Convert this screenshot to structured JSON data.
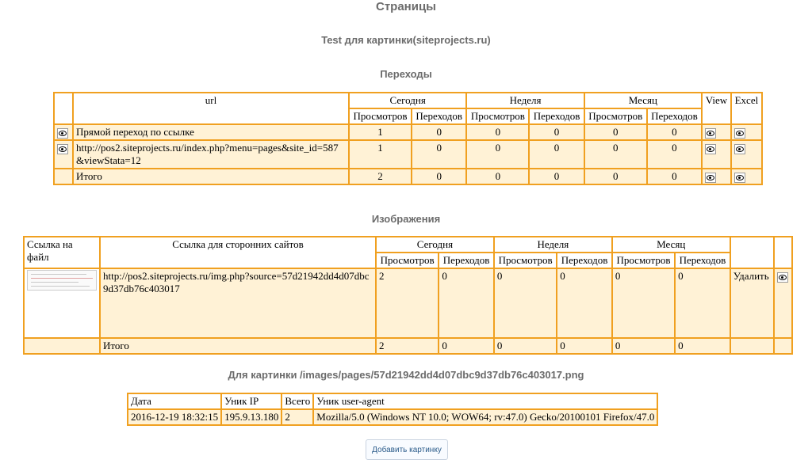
{
  "page_title": "Страницы",
  "site_title": "Test для картинки(siteprojects.ru)",
  "transitions": {
    "title": "Переходы",
    "headers": {
      "url": "url",
      "today": "Сегодня",
      "week": "Неделя",
      "month": "Месяц",
      "view": "View",
      "excel": "Excel",
      "views": "Просмотров",
      "clicks": "Переходов"
    },
    "rows": [
      {
        "url": "Прямой переход по ссылке",
        "v": [
          "1",
          "0",
          "0",
          "0",
          "0",
          "0"
        ]
      },
      {
        "url": "http://pos2.siteprojects.ru/index.php?menu=pages&site_id=587&viewStata=12",
        "v": [
          "1",
          "0",
          "0",
          "0",
          "0",
          "0"
        ]
      }
    ],
    "total": {
      "label": "Итого",
      "v": [
        "2",
        "0",
        "0",
        "0",
        "0",
        "0"
      ]
    }
  },
  "images": {
    "title": "Изображения",
    "headers": {
      "file": "Ссылка на файл",
      "external": "Ссылка для сторонних сайтов",
      "today": "Сегодня",
      "week": "Неделя",
      "month": "Месяц",
      "views": "Просмотров",
      "clicks": "Переходов"
    },
    "rows": [
      {
        "link": "http://pos2.siteprojects.ru/img.php?source=57d21942dd4d07dbc9d37db76c403017",
        "v": [
          "2",
          "0",
          "0",
          "0",
          "0",
          "0"
        ],
        "delete": "Удалить"
      }
    ],
    "total": {
      "label": "Итого",
      "v": [
        "2",
        "0",
        "0",
        "0",
        "0",
        "0"
      ]
    }
  },
  "detail": {
    "title": "Для картинки /images/pages/57d21942dd4d07dbc9d37db76c403017.png",
    "headers": {
      "date": "Дата",
      "ip": "Уник IP",
      "total": "Всего",
      "ua": "Уник user-agent"
    },
    "rows": [
      {
        "date": "2016-12-19 18:32:15",
        "ip": "195.9.13.180",
        "total": "2",
        "ua": "Mozilla/5.0 (Windows NT 10.0; WOW64; rv:47.0) Gecko/20100101 Firefox/47.0"
      }
    ]
  },
  "add_button": "Добавить картинку",
  "colors": {
    "border": "#f0a020",
    "cell_bg": "#fff2d6",
    "heading": "#6b6b6b"
  },
  "icons": {
    "view": "eye-icon"
  }
}
